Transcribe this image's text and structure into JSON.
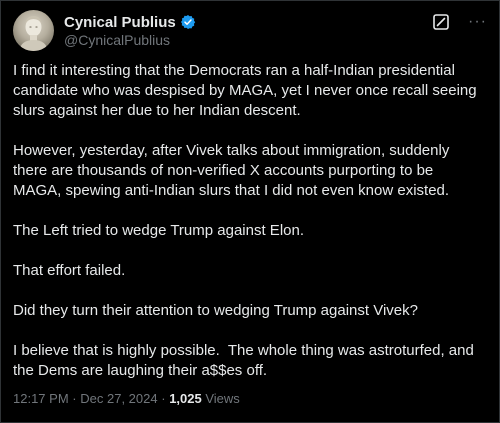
{
  "author": {
    "display_name": "Cynical Publius",
    "handle": "@CynicalPublius",
    "verified": true,
    "avatar_icon": "bust-statue-avatar"
  },
  "actions": {
    "grok_icon": "grok-icon",
    "more_icon": "more-icon",
    "more_label": "···"
  },
  "post": {
    "paragraphs": [
      "I find it interesting that the Democrats ran a half-Indian presidential candidate who was despised by MAGA, yet I never once recall seeing slurs against her due to her Indian descent.",
      "However, yesterday, after Vivek talks about immigration, suddenly there are thousands of non-verified X accounts purporting to be MAGA, spewing anti-Indian slurs that I did not even know existed.",
      "The Left tried to wedge Trump against Elon.",
      "That effort failed.",
      "Did they turn their attention to wedging Trump against Vivek?",
      "I believe that is highly possible.  The whole thing was astroturfed, and the Dems are laughing their a$$es off."
    ]
  },
  "meta": {
    "time": "12:17 PM",
    "separator": "·",
    "date": "Dec 27, 2024",
    "views_count": "1,025",
    "views_label": "Views"
  },
  "colors": {
    "background": "#000000",
    "text": "#e7e9ea",
    "secondary": "#71767b",
    "verified": "#1d9bf0"
  }
}
